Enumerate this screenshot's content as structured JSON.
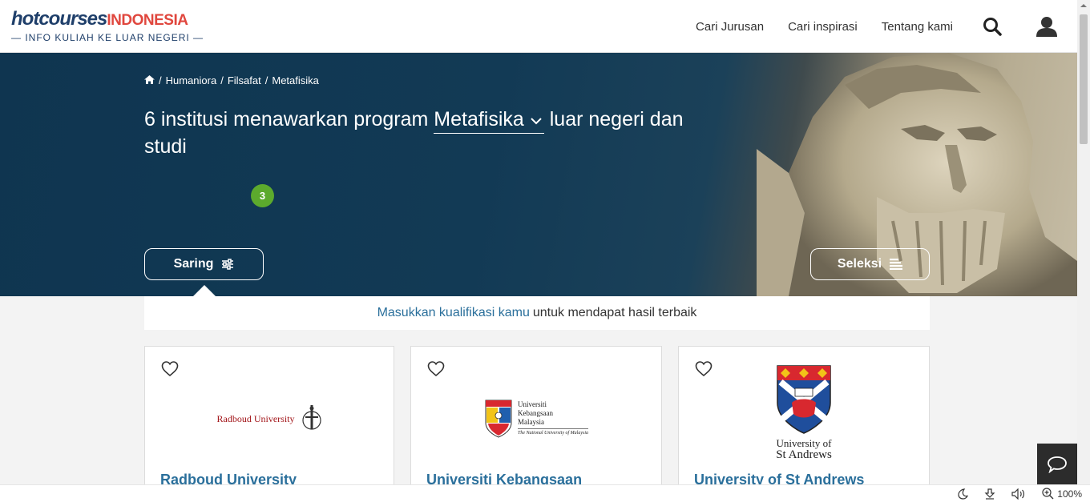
{
  "header": {
    "logo_main": "hotcourses",
    "logo_country": "INDONESIA",
    "logo_tagline": "— INFO KULIAH KE LUAR NEGERI —",
    "nav": [
      "Cari Jurusan",
      "Cari inspirasi",
      "Tentang kami"
    ]
  },
  "hero": {
    "breadcrumb": [
      "Humaniora",
      "Filsafat",
      "Metafisika"
    ],
    "title_prefix": "6 institusi menawarkan program",
    "subject": "Metafisika",
    "title_suffix": "luar negeri dan studi",
    "filter_label": "Saring",
    "filter_count": "3",
    "selection_label": "Seleksi"
  },
  "qualification": {
    "link_text": "Masukkan kualifikasi kamu",
    "rest_text": "untuk mendapat hasil terbaik"
  },
  "institutions": [
    {
      "name": "Radboud University",
      "logo_text": "Radboud University"
    },
    {
      "name": "Universiti Kebangsaan",
      "logo_line1": "Universiti",
      "logo_line2": "Kebangsaan",
      "logo_line3": "Malaysia",
      "logo_sub": "The National University of Malaysia"
    },
    {
      "name": "University of St Andrews",
      "logo_line1": "University of",
      "logo_line2": "St Andrews"
    }
  ],
  "statusbar": {
    "zoom": "100%"
  },
  "colors": {
    "brand_navy": "#1f3f6a",
    "brand_red": "#e0473e",
    "link_blue": "#2a6f9b",
    "badge_green": "#5caa2d"
  }
}
